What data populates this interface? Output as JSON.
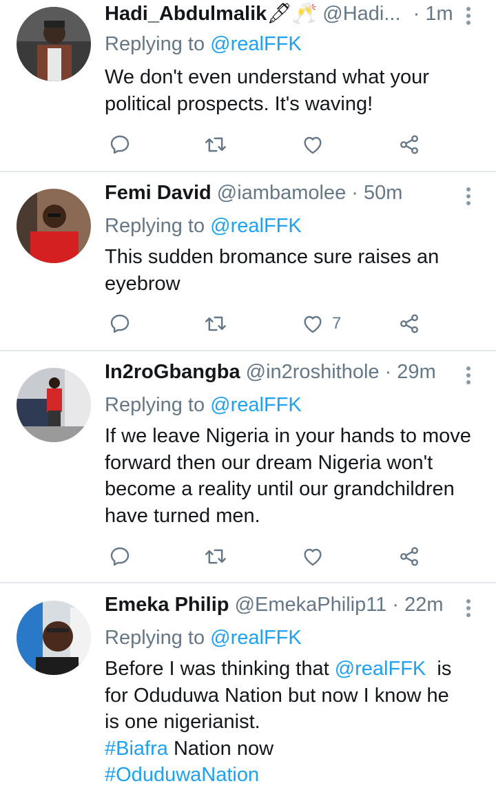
{
  "colors": {
    "accent": "#1da1f2",
    "secondary_text": "#657786",
    "divider": "#e1e8ed",
    "icon": "#657786"
  },
  "tweets": [
    {
      "name": "Hadi_Abdulmalik",
      "name_emoji": "🖋🥂",
      "handle": "@Hadi...",
      "time": "· 1m",
      "reply_prefix": "Replying to",
      "reply_to": "@realFFK",
      "lines": [
        "We don't even understand what your",
        "political prospects. It's waving!"
      ],
      "like_count": ""
    },
    {
      "name": "Femi David",
      "handle": "@iambamolee",
      "time": "· 50m",
      "reply_prefix": "Replying to",
      "reply_to": "@realFFK",
      "lines": [
        "This sudden bromance sure raises an",
        "eyebrow"
      ],
      "like_count": "7"
    },
    {
      "name": "In2roGbangba",
      "handle": "@in2roshithole",
      "time": "· 29m",
      "reply_prefix": "Replying to",
      "reply_to": "@realFFK",
      "lines": [
        "If we leave Nigeria in your hands to move",
        "forward then our dream Nigeria won't",
        "become a reality until our grandchildren",
        "have turned men."
      ],
      "like_count": ""
    },
    {
      "name": "Emeka Philip",
      "handle": "@EmekaPhilip11",
      "time": "· 22m",
      "reply_prefix": "Replying to",
      "reply_to": "@realFFK",
      "line1_pre": "Before I was thinking that ",
      "line1_mention": "@realFFK",
      "line1_post": "  is",
      "line2": "for Oduduwa Nation but now I know he",
      "line3": "is one nigerianist.",
      "hashtag1": "#Biafra",
      "line4_post": " Nation now",
      "hashtag2": "#OduduwaNation"
    }
  ]
}
